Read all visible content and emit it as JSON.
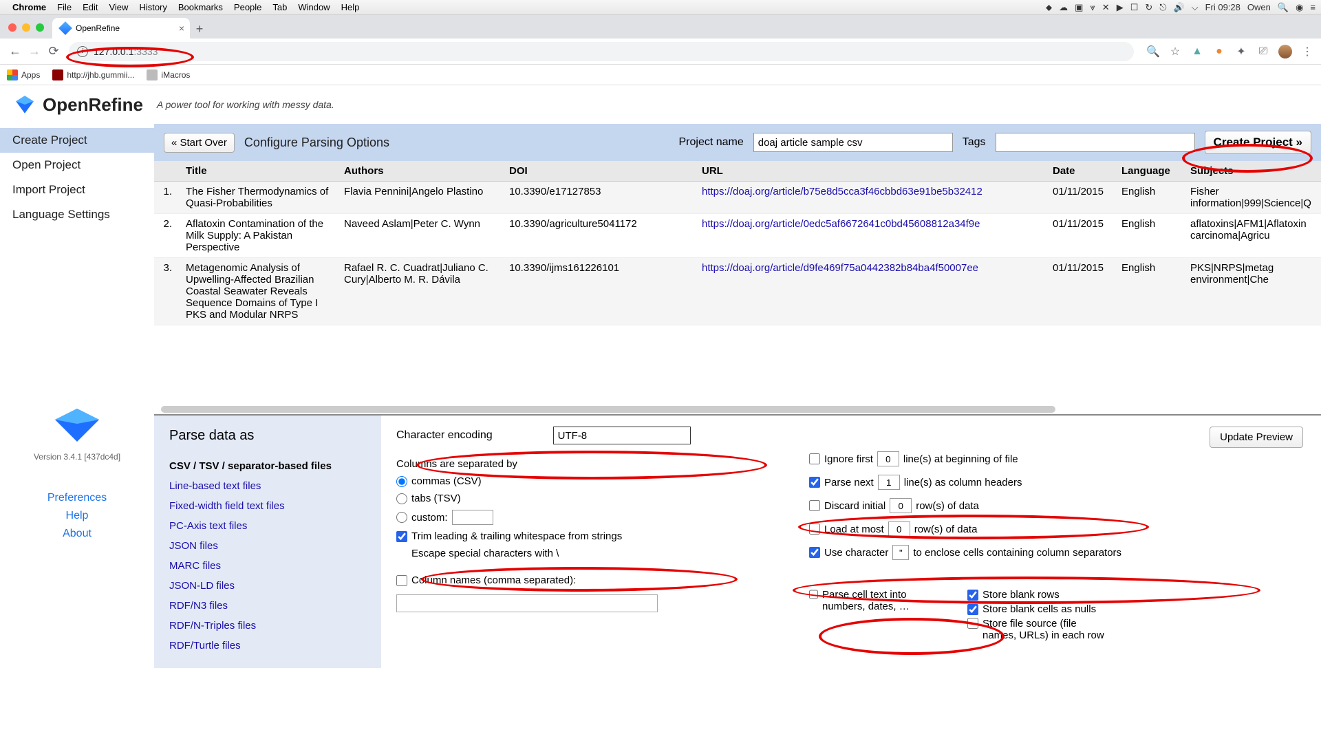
{
  "mac": {
    "app": "Chrome",
    "menus": [
      "File",
      "Edit",
      "View",
      "History",
      "Bookmarks",
      "People",
      "Tab",
      "Window",
      "Help"
    ],
    "right": {
      "time": "Fri 09:28",
      "user": "Owen"
    }
  },
  "chrome": {
    "tab_title": "OpenRefine",
    "url_host": "127.0.0.1",
    "url_port": ":3333",
    "bookmarks": {
      "apps": "Apps",
      "jhb": "http://jhb.gummii...",
      "imacros": "iMacros"
    }
  },
  "openrefine": {
    "title": "OpenRefine",
    "tagline": "A power tool for working with messy data.",
    "sidebar": {
      "nav": [
        "Create Project",
        "Open Project",
        "Import Project",
        "Language Settings"
      ],
      "version": "Version 3.4.1 [437dc4d]",
      "links": [
        "Preferences",
        "Help",
        "About"
      ]
    },
    "controls": {
      "start_over": "« Start Over",
      "configure": "Configure Parsing Options",
      "project_name_label": "Project name",
      "project_name_value": "doaj article sample csv",
      "tags_label": "Tags",
      "create": "Create Project »"
    },
    "table": {
      "headers": [
        "Title",
        "Authors",
        "DOI",
        "URL",
        "Date",
        "Language",
        "Subjects"
      ],
      "rows": [
        {
          "n": "1.",
          "title": "The Fisher Thermodynamics of Quasi-Probabilities",
          "authors": "Flavia Pennini|Angelo Plastino",
          "doi": "10.3390/e17127853",
          "url": "https://doaj.org/article/b75e8d5cca3f46cbbd63e91be5b32412",
          "date": "01/11/2015",
          "lang": "English",
          "subj": "Fisher information|999|Science|Q"
        },
        {
          "n": "2.",
          "title": "Aflatoxin Contamination of the Milk Supply: A Pakistan Perspective",
          "authors": "Naveed Aslam|Peter C. Wynn",
          "doi": "10.3390/agriculture5041172",
          "url": "https://doaj.org/article/0edc5af6672641c0bd45608812a34f9e",
          "date": "01/11/2015",
          "lang": "English",
          "subj": "aflatoxins|AFM1|Aflatoxin carcinoma|Agricu"
        },
        {
          "n": "3.",
          "title": "Metagenomic Analysis of Upwelling-Affected Brazilian Coastal Seawater Reveals Sequence Domains of Type I PKS and Modular NRPS",
          "authors": "Rafael R. C. Cuadrat|Juliano C. Cury|Alberto M. R. Dávila",
          "doi": "10.3390/ijms161226101",
          "url": "https://doaj.org/article/d9fe469f75a0442382b84ba4f50007ee",
          "date": "01/11/2015",
          "lang": "English",
          "subj": "PKS|NRPS|metag environment|Che"
        }
      ]
    },
    "parse": {
      "heading": "Parse data as",
      "formats": [
        "CSV / TSV / separator-based files",
        "Line-based text files",
        "Fixed-width field text files",
        "PC-Axis text files",
        "JSON files",
        "MARC files",
        "JSON-LD files",
        "RDF/N3 files",
        "RDF/N-Triples files",
        "RDF/Turtle files"
      ],
      "encoding_label": "Character encoding",
      "encoding_value": "UTF-8",
      "sep_label": "Columns are separated by",
      "sep_commas": "commas (CSV)",
      "sep_tabs": "tabs (TSV)",
      "sep_custom": "custom:",
      "trim": "Trim leading & trailing whitespace from strings",
      "escape": "Escape special characters with \\",
      "colnames": "Column names (comma separated):",
      "update": "Update Preview",
      "opts": {
        "ignore_first_a": "Ignore first",
        "ignore_first_n": "0",
        "ignore_first_b": "line(s) at beginning of file",
        "parse_next_a": "Parse next",
        "parse_next_n": "1",
        "parse_next_b": "line(s) as column headers",
        "discard_a": "Discard initial",
        "discard_n": "0",
        "discard_b": "row(s) of data",
        "load_a": "Load at most",
        "load_n": "0",
        "load_b": "row(s) of data",
        "usechar_a": "Use character",
        "usechar_c": "\"",
        "usechar_b": "to enclose cells containing column separators",
        "parsecell": "Parse cell text into numbers, dates, …",
        "blankrows": "Store blank rows",
        "blankcells": "Store blank cells as nulls",
        "filesource": "Store file source (file names, URLs) in each row"
      }
    }
  }
}
